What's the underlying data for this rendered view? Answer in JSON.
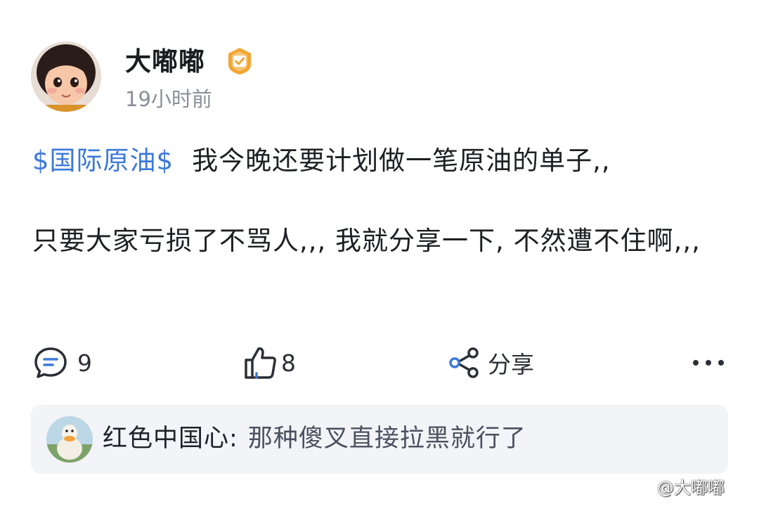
{
  "author": {
    "name": "大嘟嘟",
    "time": "19小时前",
    "badge_color": "#f2a531"
  },
  "post": {
    "stock_tag": "$国际原油$",
    "line1": "我今晚还要计划做一笔原油的单子,,",
    "line2": "只要大家亏损了不骂人,,, 我就分享一下, 不然遭不住啊,,,",
    "tag_color": "#3d79d8"
  },
  "actions": {
    "comment_icon": "comment-icon",
    "comment_count": "9",
    "like_icon": "thumbs-up-icon",
    "like_count": "8",
    "share_icon": "share-icon",
    "share_label": "分享",
    "more_icon": "more-icon"
  },
  "reply": {
    "user": "红色中国心",
    "separator": ":",
    "text": "那种傻叉直接拉黑就行了"
  },
  "watermark": "@大嘟嘟"
}
